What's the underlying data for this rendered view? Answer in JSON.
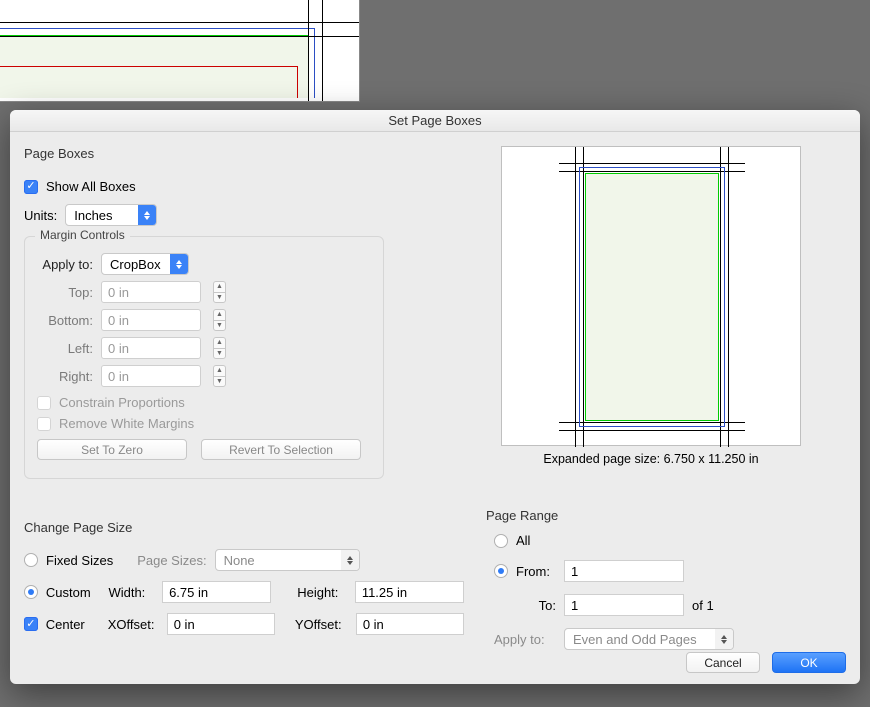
{
  "dialog": {
    "title": "Set Page Boxes"
  },
  "pageBoxes": {
    "section": "Page Boxes",
    "showAll": {
      "label": "Show All Boxes",
      "checked": true
    },
    "units": {
      "label": "Units:",
      "value": "Inches"
    },
    "marginControls": {
      "legend": "Margin Controls",
      "applyTo": {
        "label": "Apply to:",
        "value": "CropBox"
      },
      "top": {
        "label": "Top:",
        "value": "0 in"
      },
      "bottom": {
        "label": "Bottom:",
        "value": "0 in"
      },
      "left": {
        "label": "Left:",
        "value": "0 in"
      },
      "right": {
        "label": "Right:",
        "value": "0 in"
      },
      "constrain": {
        "label": "Constrain Proportions",
        "checked": false
      },
      "removeWhite": {
        "label": "Remove White Margins",
        "checked": false
      },
      "setZero": "Set To Zero",
      "revert": "Revert To Selection"
    }
  },
  "preview": {
    "caption": "Expanded page size: 6.750 x 11.250 in"
  },
  "changePageSize": {
    "section": "Change Page Size",
    "fixed": {
      "label": "Fixed Sizes",
      "selected": false
    },
    "pageSizes": {
      "label": "Page Sizes:",
      "value": "None"
    },
    "custom": {
      "label": "Custom",
      "selected": true
    },
    "width": {
      "label": "Width:",
      "value": "6.75 in"
    },
    "height": {
      "label": "Height:",
      "value": "11.25 in"
    },
    "center": {
      "label": "Center",
      "checked": true
    },
    "xoffset": {
      "label": "XOffset:",
      "value": "0 in"
    },
    "yoffset": {
      "label": "YOffset:",
      "value": "0 in"
    }
  },
  "pageRange": {
    "section": "Page Range",
    "all": {
      "label": "All",
      "selected": false
    },
    "from": {
      "label": "From:",
      "value": "1",
      "selected": true
    },
    "to": {
      "label": "To:",
      "value": "1",
      "suffix": "of 1"
    },
    "applyTo": {
      "label": "Apply to:",
      "value": "Even and Odd Pages"
    }
  },
  "footer": {
    "cancel": "Cancel",
    "ok": "OK"
  }
}
